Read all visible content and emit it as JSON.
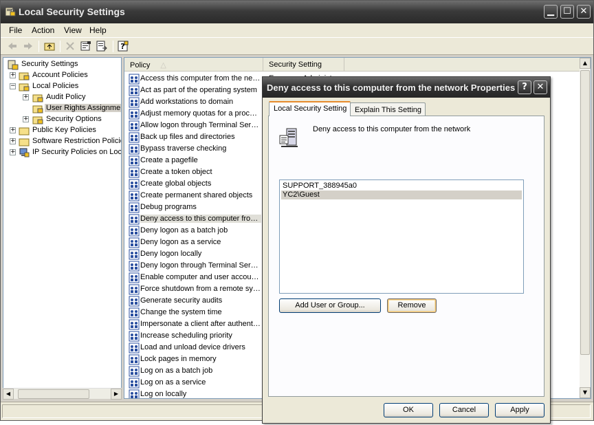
{
  "window": {
    "title": "Local Security Settings",
    "buttons": {
      "minimize": "▁",
      "maximize": "☐",
      "close": "✕"
    }
  },
  "menu": {
    "file": "File",
    "action": "Action",
    "view": "View",
    "help": "Help"
  },
  "tree": {
    "root": "Security Settings",
    "items": [
      {
        "label": "Account Policies",
        "expander": "+"
      },
      {
        "label": "Local Policies",
        "expander": "−"
      },
      {
        "label": "Audit Policy",
        "expander": "+"
      },
      {
        "label": "User Rights Assignment",
        "expander": ""
      },
      {
        "label": "Security Options",
        "expander": "+"
      },
      {
        "label": "Public Key Policies",
        "expander": "+"
      },
      {
        "label": "Software Restriction Policies",
        "expander": "+"
      },
      {
        "label": "IP Security Policies on Local Computer",
        "expander": "+"
      }
    ]
  },
  "list": {
    "columns": {
      "policy": "Policy",
      "sort_indicator": "△",
      "setting": "Security Setting"
    },
    "rows": [
      {
        "name": "Access this computer from the network",
        "setting": "Everyone,Administr..."
      },
      {
        "name": "Act as part of the operating system",
        "setting": ""
      },
      {
        "name": "Add workstations to domain",
        "setting": ""
      },
      {
        "name": "Adjust memory quotas for a process",
        "setting": ""
      },
      {
        "name": "Allow logon through Terminal Services",
        "setting": ""
      },
      {
        "name": "Back up files and directories",
        "setting": ""
      },
      {
        "name": "Bypass traverse checking",
        "setting": ""
      },
      {
        "name": "Create a pagefile",
        "setting": ""
      },
      {
        "name": "Create a token object",
        "setting": ""
      },
      {
        "name": "Create global objects",
        "setting": ""
      },
      {
        "name": "Create permanent shared objects",
        "setting": ""
      },
      {
        "name": "Debug programs",
        "setting": ""
      },
      {
        "name": "Deny access to this computer from the network",
        "setting": ""
      },
      {
        "name": "Deny logon as a batch job",
        "setting": ""
      },
      {
        "name": "Deny logon as a service",
        "setting": ""
      },
      {
        "name": "Deny logon locally",
        "setting": ""
      },
      {
        "name": "Deny logon through Terminal Services",
        "setting": ""
      },
      {
        "name": "Enable computer and user accounts to be trusted for delegation",
        "setting": ""
      },
      {
        "name": "Force shutdown from a remote system",
        "setting": ""
      },
      {
        "name": "Generate security audits",
        "setting": ""
      },
      {
        "name": "Change the system time",
        "setting": ""
      },
      {
        "name": "Impersonate a client after authentication",
        "setting": ""
      },
      {
        "name": "Increase scheduling priority",
        "setting": ""
      },
      {
        "name": "Load and unload device drivers",
        "setting": ""
      },
      {
        "name": "Lock pages in memory",
        "setting": ""
      },
      {
        "name": "Log on as a batch job",
        "setting": ""
      },
      {
        "name": "Log on as a service",
        "setting": ""
      },
      {
        "name": "Log on locally",
        "setting": ""
      }
    ]
  },
  "dialog": {
    "title": "Deny access to this computer from the network Properties",
    "help_btn": "?",
    "close_btn": "✕",
    "tabs": {
      "local": "Local Security Setting",
      "explain": "Explain This Setting"
    },
    "policy_name": "Deny access to this computer from the network",
    "accounts": [
      "SUPPORT_388945a0",
      "YC2\\Guest"
    ],
    "add_button": "Add User or Group...",
    "remove_button": "Remove",
    "ok": "OK",
    "cancel": "Cancel",
    "apply": "Apply"
  },
  "colors": {
    "selection": "#d4d0c8",
    "border": "#7f9db9",
    "dialog_bg": "#ece9d8"
  }
}
